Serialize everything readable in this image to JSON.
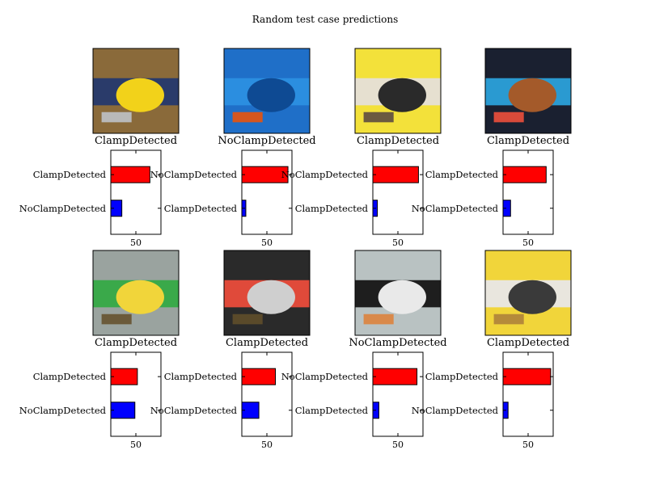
{
  "figure": {
    "title": "Random test case predictions",
    "colors": {
      "top_bar": "#ff0000",
      "bottom_bar": "#0000ff",
      "axes": "#000000"
    },
    "xaxis_tick": 50,
    "xlim": [
      0,
      100
    ]
  },
  "chart_data": [
    {
      "type": "bar",
      "image_label": "ClampDetected",
      "photo_description": "yellow pipe with metal clamp and handle",
      "categories": [
        "ClampDetected",
        "NoClampDetected"
      ],
      "values": [
        78,
        22
      ],
      "xlim": [
        0,
        100
      ],
      "xticks": [
        50
      ]
    },
    {
      "type": "bar",
      "image_label": "NoClampDetected",
      "photo_description": "blue plastic crate",
      "categories": [
        "NoClampDetected",
        "ClampDetected"
      ],
      "values": [
        92,
        8
      ],
      "xlim": [
        0,
        100
      ],
      "xticks": [
        50
      ]
    },
    {
      "type": "bar",
      "image_label": "ClampDetected",
      "photo_description": "yellow pipe with clamp in trench",
      "categories": [
        "NoClampDetected",
        "ClampDetected"
      ],
      "values": [
        91,
        9
      ],
      "xlim": [
        0,
        100
      ],
      "xticks": [
        50
      ]
    },
    {
      "type": "bar",
      "image_label": "ClampDetected",
      "photo_description": "copper pipe with blue sleeve",
      "categories": [
        "ClampDetected",
        "NoClampDetected"
      ],
      "values": [
        86,
        15
      ],
      "xlim": [
        0,
        100
      ],
      "xticks": [
        50
      ]
    },
    {
      "type": "bar",
      "image_label": "ClampDetected",
      "photo_description": "grey and green pipes over yellow pipe",
      "categories": [
        "ClampDetected",
        "NoClampDetected"
      ],
      "values": [
        53,
        48
      ],
      "xlim": [
        0,
        100
      ],
      "xticks": [
        50
      ]
    },
    {
      "type": "bar",
      "image_label": "ClampDetected",
      "photo_description": "black pipe fitting with wires",
      "categories": [
        "ClampDetected",
        "NoClampDetected"
      ],
      "values": [
        67,
        34
      ],
      "xlim": [
        0,
        100
      ],
      "xticks": [
        50
      ]
    },
    {
      "type": "bar",
      "image_label": "NoClampDetected",
      "photo_description": "black rubber fitting on grey background",
      "categories": [
        "NoClampDetected",
        "ClampDetected"
      ],
      "values": [
        88,
        12
      ],
      "xlim": [
        0,
        100
      ],
      "xticks": [
        50
      ]
    },
    {
      "type": "bar",
      "image_label": "ClampDetected",
      "photo_description": "yellow pipe with white wrap and clamp",
      "categories": [
        "ClampDetected",
        "NoClampDetected"
      ],
      "values": [
        95,
        10
      ],
      "xlim": [
        0,
        100
      ],
      "xticks": [
        50
      ]
    }
  ]
}
